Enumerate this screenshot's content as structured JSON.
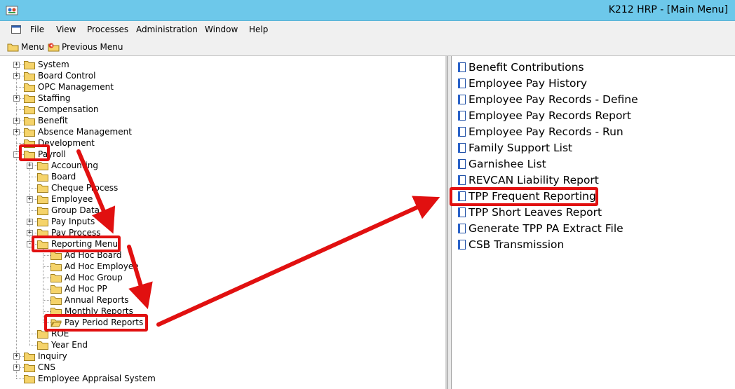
{
  "window": {
    "title": "K212 HRP - [Main Menu]"
  },
  "menubar": {
    "items": [
      "File",
      "View",
      "Processes",
      "Administration",
      "Window",
      "Help"
    ]
  },
  "toolbar": {
    "menu_label": "Menu",
    "previous_menu_label": "Previous Menu"
  },
  "tree": [
    {
      "label": "System",
      "level": 0,
      "expander": "+"
    },
    {
      "label": "Board Control",
      "level": 0,
      "expander": "+"
    },
    {
      "label": "OPC Management",
      "level": 0,
      "expander": ""
    },
    {
      "label": "Staffing",
      "level": 0,
      "expander": "+"
    },
    {
      "label": "Compensation",
      "level": 0,
      "expander": ""
    },
    {
      "label": "Benefit",
      "level": 0,
      "expander": "+"
    },
    {
      "label": "Absence Management",
      "level": 0,
      "expander": "+"
    },
    {
      "label": "Development",
      "level": 0,
      "expander": ""
    },
    {
      "label": "Payroll",
      "level": 0,
      "expander": "-"
    },
    {
      "label": "Accounting",
      "level": 1,
      "expander": "+"
    },
    {
      "label": "Board",
      "level": 1,
      "expander": ""
    },
    {
      "label": "Cheque Process",
      "level": 1,
      "expander": ""
    },
    {
      "label": "Employee",
      "level": 1,
      "expander": "+"
    },
    {
      "label": "Group Data",
      "level": 1,
      "expander": ""
    },
    {
      "label": "Pay Inputs",
      "level": 1,
      "expander": "+"
    },
    {
      "label": "Pay Process",
      "level": 1,
      "expander": "+"
    },
    {
      "label": "Reporting Menu",
      "level": 1,
      "expander": "-"
    },
    {
      "label": "Ad Hoc Board",
      "level": 2,
      "expander": ""
    },
    {
      "label": "Ad Hoc Employee",
      "level": 2,
      "expander": ""
    },
    {
      "label": "Ad Hoc Group",
      "level": 2,
      "expander": ""
    },
    {
      "label": "Ad Hoc PP",
      "level": 2,
      "expander": ""
    },
    {
      "label": "Annual Reports",
      "level": 2,
      "expander": ""
    },
    {
      "label": "Monthly Reports",
      "level": 2,
      "expander": ""
    },
    {
      "label": "Pay Period Reports",
      "level": 2,
      "expander": "",
      "open": true
    },
    {
      "label": "ROE",
      "level": 1,
      "expander": ""
    },
    {
      "label": "Year End",
      "level": 1,
      "expander": ""
    },
    {
      "label": "Inquiry",
      "level": 0,
      "expander": "+"
    },
    {
      "label": "CNS",
      "level": 0,
      "expander": "+"
    },
    {
      "label": "Employee Appraisal System",
      "level": 0,
      "expander": ""
    }
  ],
  "reports": [
    "Benefit Contributions",
    "Employee Pay History",
    "Employee Pay Records - Define",
    "Employee Pay Records Report",
    "Employee Pay Records - Run",
    "Family Support List",
    "Garnishee List",
    "REVCAN Liability Report",
    "TPP Frequent Reporting",
    "TPP Short Leaves Report",
    "Generate TPP PA Extract File",
    "CSB Transmission"
  ],
  "colors": {
    "titlebar": "#6dc8ea",
    "highlight": "#e11010",
    "folder": "#f5d36a"
  }
}
